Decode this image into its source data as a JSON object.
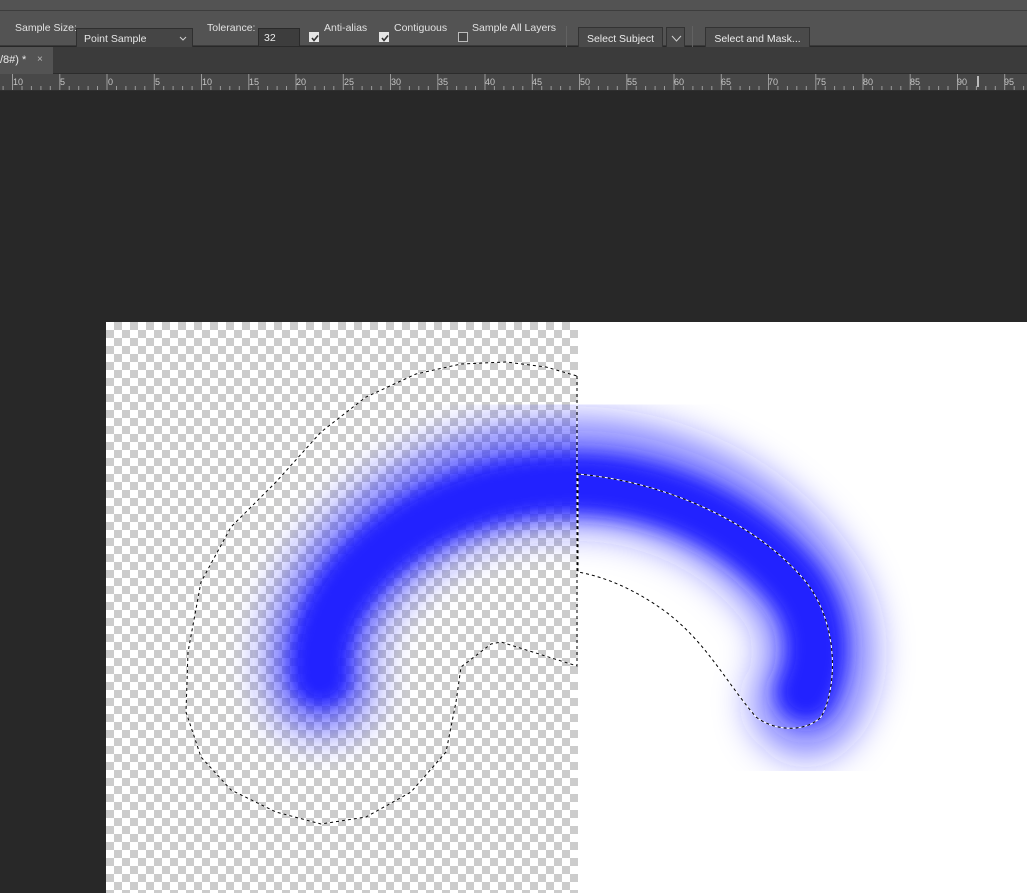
{
  "options_bar": {
    "sample_size_label": "Sample Size:",
    "sample_size_value": "Point Sample",
    "tolerance_label": "Tolerance:",
    "tolerance_value": "32",
    "anti_alias_label": "Anti-alias",
    "anti_alias_checked": true,
    "contiguous_label": "Contiguous",
    "contiguous_checked": true,
    "sample_all_layers_label": "Sample All Layers",
    "sample_all_layers_checked": false,
    "select_subject_label": "Select Subject",
    "select_and_mask_label": "Select and Mask..."
  },
  "document_tab": {
    "title": "/8#) *",
    "close_glyph": "×"
  },
  "ruler": {
    "labels": [
      "10",
      "5",
      "0",
      "5",
      "10",
      "15",
      "20",
      "25",
      "30",
      "35",
      "40",
      "45",
      "50",
      "55",
      "60",
      "65",
      "70",
      "75",
      "80",
      "85",
      "90",
      "95"
    ]
  },
  "colors": {
    "stroke_color": "#2020ff",
    "panel_bg": "#535353",
    "workspace_bg": "#282828"
  }
}
